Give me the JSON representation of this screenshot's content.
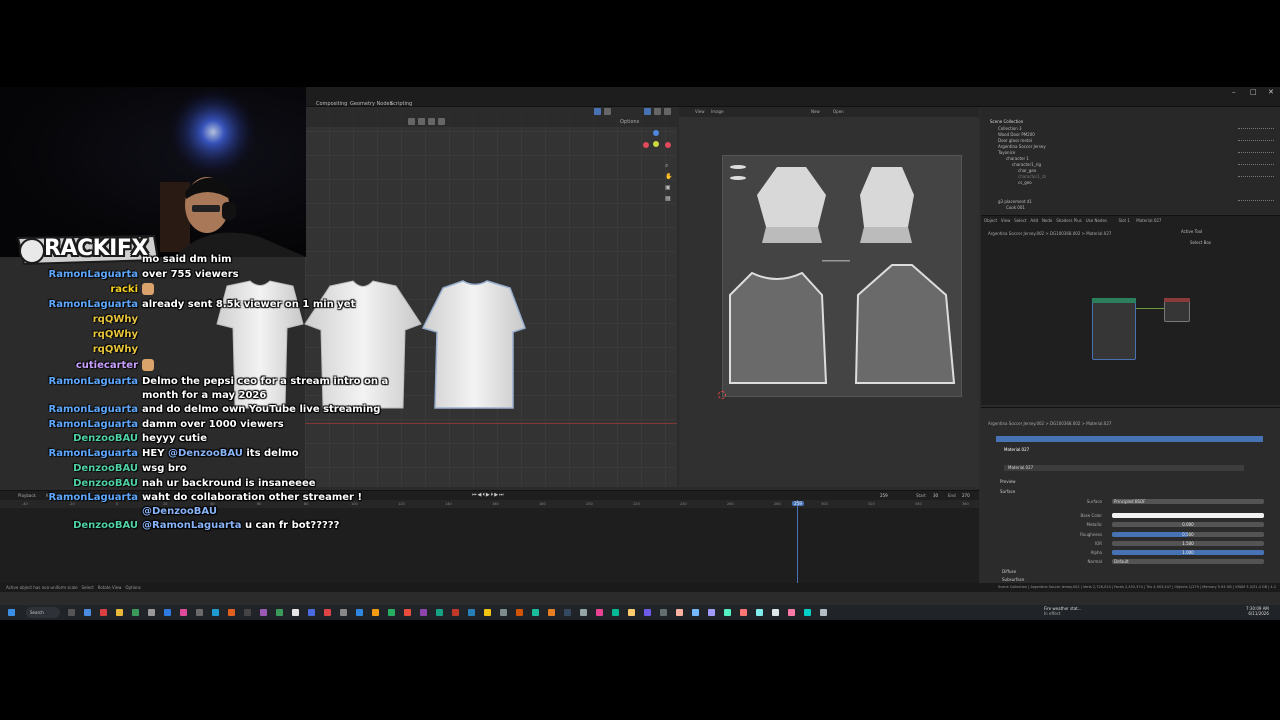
{
  "blender": {
    "workspace_tabs": [
      "Compositing",
      "Geometry Nodes",
      "Scripting"
    ],
    "viewport": {
      "options_label": "Options"
    },
    "uv_editor": {
      "view_label": "View",
      "image_label": "Image",
      "new_label": "New",
      "open_label": "Open"
    },
    "outliner": {
      "title": "Scene Collection",
      "rows": [
        "Collection 3",
        "Wood Door PM200",
        "Door glass metal",
        "Argentina Soccer Jersey",
        "Tayonice",
        "character 1",
        "character1_rig",
        "char_geo",
        "character1_rb",
        "cs_geo",
        "g3 placement d1",
        "Cook 001"
      ]
    },
    "node_editor": {
      "menu": [
        "Object",
        "View",
        "Select",
        "Add",
        "Node",
        "Shaders Plus",
        "Use Nodes",
        "Slot 1",
        "Material.027"
      ],
      "breadcrumb": [
        "Argentina Soccer Jersey.002",
        "DG100368.002",
        "Material.027"
      ],
      "side_panel_title": "Active Tool",
      "side_panel_item": "Select Box"
    },
    "properties": {
      "breadcrumb": [
        "Argentina Soccer Jersey.002",
        "DG100368.002",
        "Material.027"
      ],
      "material_slot": "Material.027",
      "material_name": "Material.027",
      "sections": [
        "Preview",
        "Surface"
      ],
      "surface_shader": "Principled BSDF",
      "fields": [
        {
          "label": "Surface",
          "value": "Principled BSDF",
          "fill": 0
        },
        {
          "label": "Base Color",
          "value": "",
          "fill": 1.0,
          "color": "#f2f2f2"
        },
        {
          "label": "Metallic",
          "value": "0.000",
          "fill": 0
        },
        {
          "label": "Roughness",
          "value": "0.500",
          "fill": 0.5
        },
        {
          "label": "IOR",
          "value": "1.500",
          "fill": 0
        },
        {
          "label": "Alpha",
          "value": "1.000",
          "fill": 1.0
        },
        {
          "label": "Normal",
          "value": "Default",
          "fill": 0
        }
      ],
      "subsections": [
        "Diffuse",
        "Subsurface"
      ]
    },
    "timeline": {
      "playback_label": "Playback",
      "keying_label": "Keying",
      "current_frame": "259",
      "start_label": "Start",
      "start_value": "30",
      "end_label": "End",
      "end_value": "270",
      "ticks": [
        "-40",
        "-20",
        "0",
        "20",
        "40",
        "60",
        "80",
        "100",
        "120",
        "140",
        "160",
        "180",
        "200",
        "220",
        "240",
        "260",
        "280",
        "300",
        "320",
        "340",
        "360"
      ],
      "playhead_frame": "259"
    },
    "status_left": [
      "Active object has non-uniform scale",
      "Select",
      "Rotate View",
      "Options"
    ],
    "status_right": "Scene Collection | Argentina Soccer Jersey.002 | Verts 2,726,024 | Faces 2,452,374 | Tris 4,903,447 | Objects 1/279 | Memory 5.94 GB | VRAM 3.3/31.4 GB | 4.2"
  },
  "taskbar": {
    "search_label": "Search",
    "weather_line1": "Fire weather stat...",
    "weather_line2": "In effect",
    "time": "7:30:09 AM",
    "date": "6/11/2026"
  },
  "overlay": {
    "logo_text": "RACKIFX"
  },
  "chat": [
    {
      "name": "",
      "color": "#ffffff",
      "msg": "mo said dm him",
      "mention": ""
    },
    {
      "name": "RamonLaguarta",
      "color": "#5fa8ff",
      "msg": "over 755 viewers",
      "mention": ""
    },
    {
      "name": "racki",
      "color": "#f7d11e",
      "msg": "",
      "mention": "",
      "emote": true
    },
    {
      "name": "RamonLaguarta",
      "color": "#5fa8ff",
      "msg": "already sent 8.5k viewer on 1 min yet",
      "mention": ""
    },
    {
      "name": "rqQWhy",
      "color": "#e8c53a",
      "msg": "",
      "mention": ""
    },
    {
      "name": "rqQWhy",
      "color": "#e8c53a",
      "msg": "",
      "mention": ""
    },
    {
      "name": "rqQWhy",
      "color": "#e8c53a",
      "msg": "",
      "mention": ""
    },
    {
      "name": "cutiecarter",
      "color": "#c9a0ff",
      "msg": "",
      "mention": "",
      "emote": true
    },
    {
      "name": "RamonLaguarta",
      "color": "#5fa8ff",
      "msg": "Delmo the pepsi ceo for a stream intro on a month for a may 2026",
      "mention": ""
    },
    {
      "name": "RamonLaguarta",
      "color": "#5fa8ff",
      "msg": "and do delmo own YouTube live streaming",
      "mention": ""
    },
    {
      "name": "RamonLaguarta",
      "color": "#5fa8ff",
      "msg": "damm over 1000 viewers",
      "mention": ""
    },
    {
      "name": "DenzooBAU",
      "color": "#4fd1a5",
      "msg": "heyyy cutie",
      "mention": ""
    },
    {
      "name": "RamonLaguarta",
      "color": "#5fa8ff",
      "msg": "HEY ",
      "mention": "@DenzooBAU",
      "msg_after": " its delmo"
    },
    {
      "name": "DenzooBAU",
      "color": "#4fd1a5",
      "msg": "wsg bro",
      "mention": ""
    },
    {
      "name": "DenzooBAU",
      "color": "#4fd1a5",
      "msg": "nah ur backround is insaneeee",
      "mention": ""
    },
    {
      "name": "RamonLaguarta",
      "color": "#5fa8ff",
      "msg": "waht do collaboration other streamer !",
      "mention": "@DenzooBAU",
      "mention_newline": true
    },
    {
      "name": "DenzooBAU",
      "color": "#4fd1a5",
      "msg": "",
      "mention": "@RamonLaguarta",
      "msg_after": " u can fr bot?????"
    }
  ]
}
